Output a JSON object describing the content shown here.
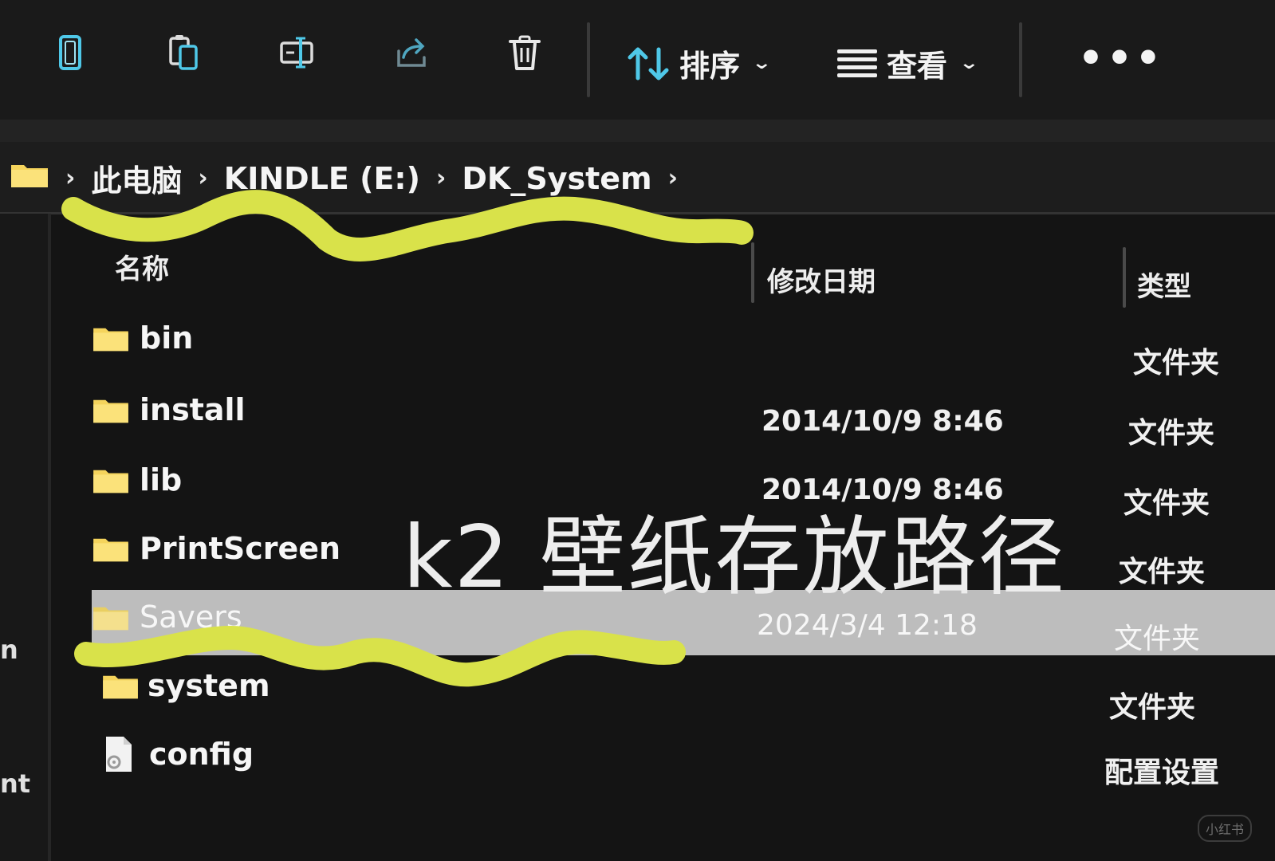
{
  "toolbar": {
    "sort_label": "排序",
    "view_label": "查看",
    "more_label": "•••",
    "icons": [
      "new-icon",
      "copy-icon",
      "rename-icon",
      "share-icon",
      "delete-icon",
      "sort-icon",
      "view-icon",
      "more-icon"
    ]
  },
  "breadcrumb": {
    "items": [
      "此电脑",
      "KINDLE (E:)",
      "DK_System"
    ],
    "separator": "›"
  },
  "columns": {
    "name": "名称",
    "date": "修改日期",
    "type": "类型"
  },
  "files": [
    {
      "name": "bin",
      "date": "",
      "type": "文件夹",
      "icon": "folder-icon"
    },
    {
      "name": "install",
      "date": "2014/10/9 8:46",
      "type": "文件夹",
      "icon": "folder-icon"
    },
    {
      "name": "lib",
      "date": "2014/10/9 8:46",
      "type": "文件夹",
      "icon": "folder-icon"
    },
    {
      "name": "PrintScreen",
      "date": "",
      "type": "文件夹",
      "icon": "folder-icon"
    },
    {
      "name": "Savers",
      "date": "2024/3/4 12:18",
      "type": "文件夹",
      "icon": "folder-icon",
      "selected": true
    },
    {
      "name": "system",
      "date": "",
      "type": "文件夹",
      "icon": "folder-icon"
    },
    {
      "name": "config",
      "date": "",
      "type": "配置设置",
      "icon": "config-file-icon"
    }
  ],
  "nav_fragments": [
    "n",
    "nt"
  ],
  "overlay": {
    "caption": "k2 壁纸存放路径"
  },
  "watermark": "小红书",
  "colors": {
    "background": "#141414",
    "selected_row": "#bdbdbd",
    "folder": "#f5d45c",
    "icon_accent": "#4fc8e8",
    "highlight_scribble": "#d9e24a"
  }
}
